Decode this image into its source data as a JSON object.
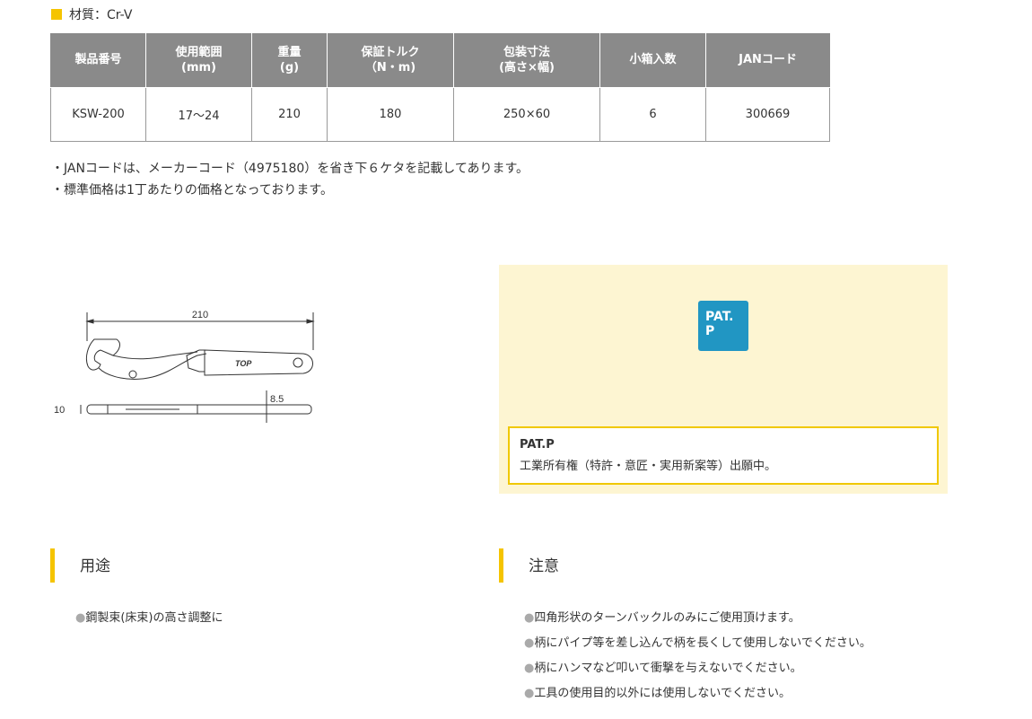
{
  "material": "材質：Cr-V",
  "table": {
    "headers": [
      [
        "製品番号"
      ],
      [
        "使用範囲",
        "(mm)"
      ],
      [
        "重量",
        "(g)"
      ],
      [
        "保証トルク",
        "（N・m)"
      ],
      [
        "包装寸法",
        "(高さ×幅)"
      ],
      [
        "小箱入数"
      ],
      [
        "JANコード"
      ]
    ],
    "rows": [
      [
        "KSW-200",
        "17〜24",
        "210",
        "180",
        "250×60",
        "6",
        "300669"
      ]
    ]
  },
  "notes": [
    "・JANコードは、メーカーコード（4975180）を省き下６ケタを記載してあります。",
    "・標準価格は1丁あたりの価格となっております。"
  ],
  "diagram": {
    "length_label": "210",
    "thickness_label": "10",
    "handle_label": "8.5",
    "brand": "TOP"
  },
  "pat": {
    "logo_line1": "PAT.",
    "logo_line2": "P",
    "title": "PAT.P",
    "description": "工業所有権（特許・意匠・実用新案等）出願中。"
  },
  "usage": {
    "heading": "用途",
    "items": [
      "鋼製束(床束)の高さ調整に"
    ]
  },
  "caution": {
    "heading": "注意",
    "items": [
      "四角形状のターンバックルのみにご使用頂けます。",
      "柄にパイプ等を差し込んで柄を長くして使用しないでください。",
      "柄にハンマなど叩いて衝撃を与えないでください。",
      "工具の使用目的以外には使用しないでください。"
    ]
  },
  "colors": {
    "accent": "#f5c400",
    "header_bg": "#8a8a8a",
    "pat_bg": "#fdf5d2",
    "pat_logo": "#2196c3"
  }
}
